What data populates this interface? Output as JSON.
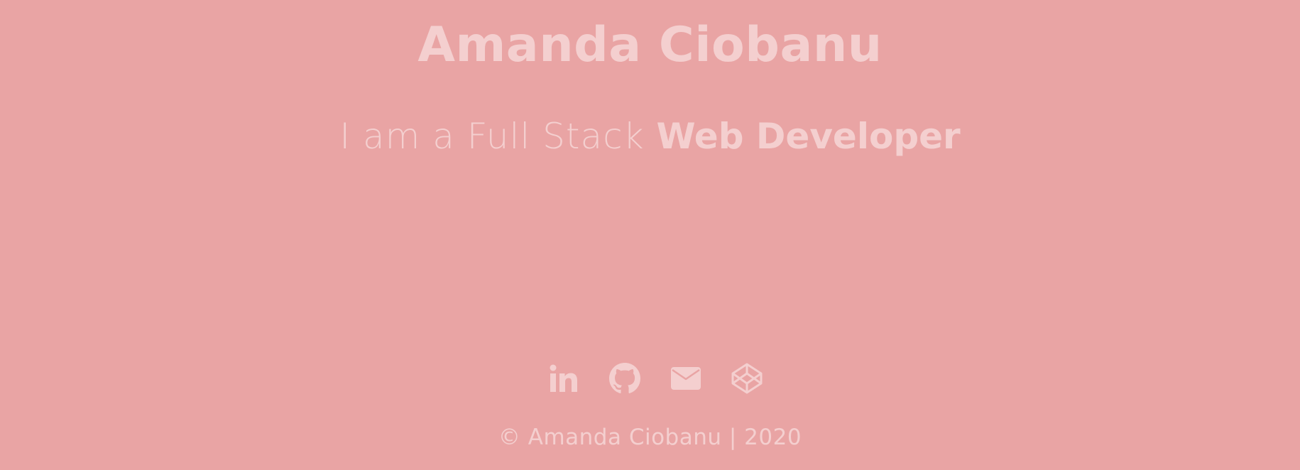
{
  "header": {
    "name": "Amanda Ciobanu"
  },
  "hero": {
    "tagline_prefix": "I am a Full Stack ",
    "tagline_highlight": "Web Developer"
  },
  "social": [
    {
      "icon": "linkedin-icon"
    },
    {
      "icon": "github-icon"
    },
    {
      "icon": "email-icon"
    },
    {
      "icon": "codepen-icon"
    }
  ],
  "footer": {
    "copyright": "© Amanda Ciobanu | 2020"
  },
  "colors": {
    "background": "#e9a4a4",
    "text": "#f4cfcf"
  }
}
